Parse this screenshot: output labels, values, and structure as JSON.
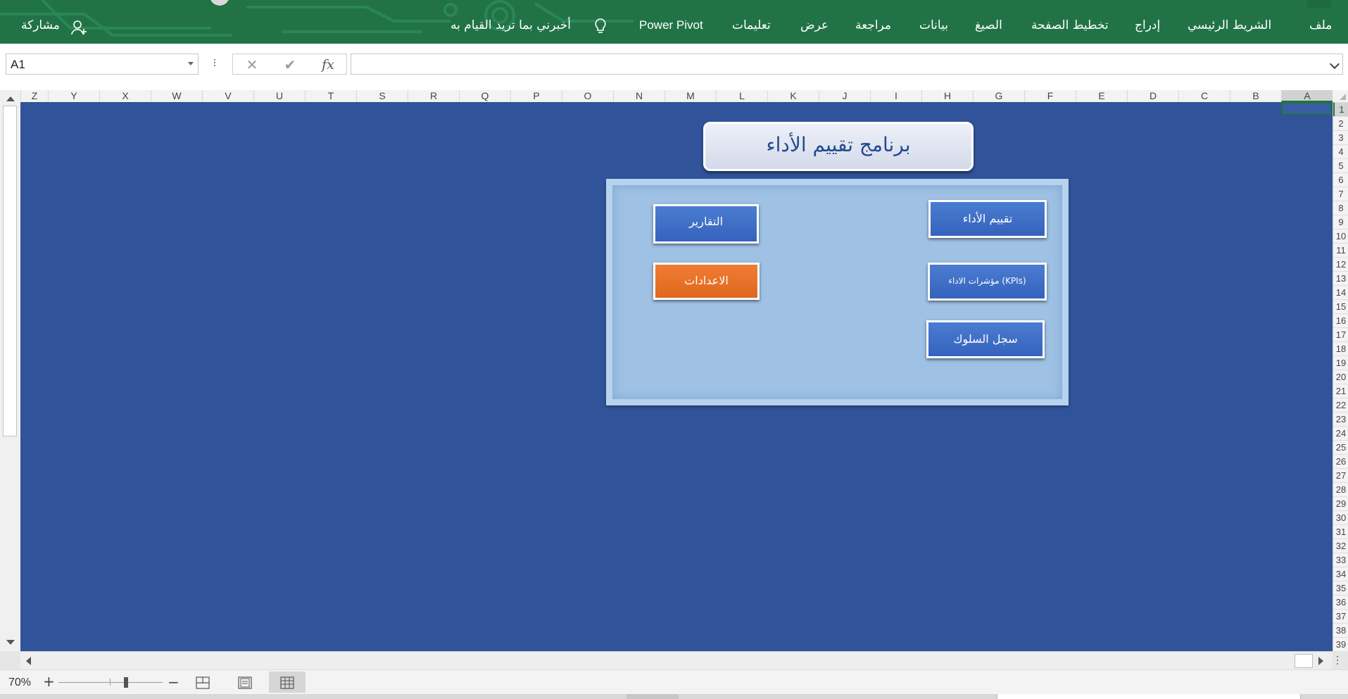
{
  "ribbon": {
    "tabs": [
      "ملف",
      "الشريط الرئيسي",
      "إدراج",
      "تخطيط الصفحة",
      "الصيغ",
      "بيانات",
      "مراجعة",
      "عرض",
      "تعليمات",
      "Power Pivot"
    ],
    "tell_me": "أخبرني بما تريد القيام به",
    "share": "مشاركة",
    "color": "#217346"
  },
  "formula_bar": {
    "name_box": "A1",
    "cancel_icon": "cancel-icon",
    "enter_icon": "check-icon",
    "fx_label": "fx",
    "formula_value": ""
  },
  "grid": {
    "columns": [
      "A",
      "B",
      "C",
      "D",
      "E",
      "F",
      "G",
      "H",
      "I",
      "J",
      "K",
      "L",
      "M",
      "N",
      "O",
      "P",
      "Q",
      "R",
      "S",
      "T",
      "U",
      "V",
      "W",
      "X",
      "Y",
      "Z"
    ],
    "rows": [
      "1",
      "2",
      "3",
      "4",
      "5",
      "6",
      "7",
      "8",
      "9",
      "10",
      "11",
      "12",
      "13",
      "14",
      "15",
      "16",
      "17",
      "18",
      "19",
      "20",
      "21",
      "22",
      "23",
      "24",
      "25",
      "26",
      "27",
      "28",
      "29",
      "30",
      "31",
      "32",
      "33",
      "34",
      "35",
      "36",
      "37",
      "38",
      "39"
    ],
    "selected_cell": "A1",
    "sheet_background": "#31539a"
  },
  "dashboard": {
    "title": "برنامج تقييم الأداء",
    "buttons": {
      "reports": "التقارير",
      "settings": "الاعدادات",
      "evaluation": "تقييم الأداء",
      "kpis": "مؤشرات الاداء (KPIs)",
      "behavior": "سجل السلوك"
    },
    "colors": {
      "blue_button": "#3f6fc9",
      "orange_button": "#e8722a",
      "panel": "#9ec1e4"
    }
  },
  "status_bar": {
    "zoom": "70%",
    "zoom_in": "+",
    "zoom_out": "−",
    "views": [
      "page-break-view",
      "page-layout-view",
      "normal-view"
    ]
  }
}
